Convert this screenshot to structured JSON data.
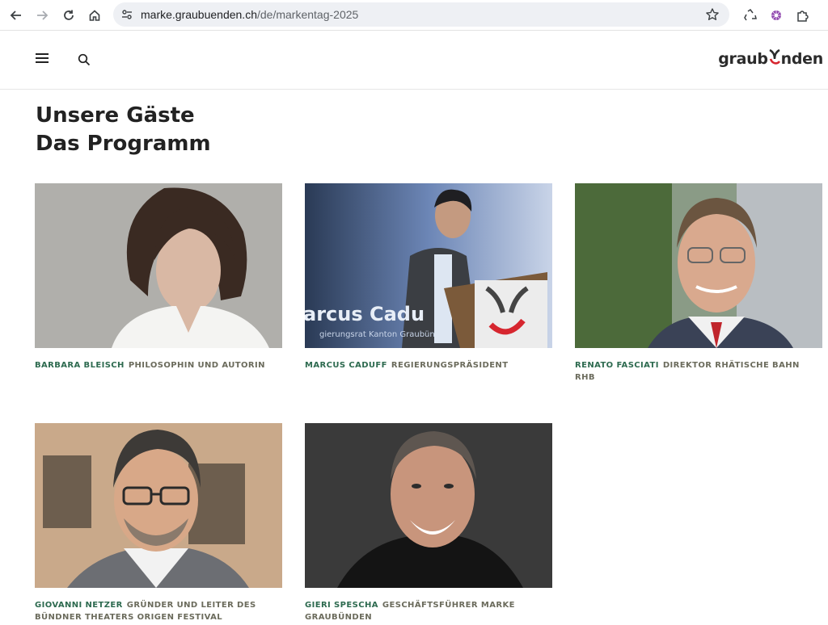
{
  "browser": {
    "url_host": "marke.graubuenden.ch",
    "url_path": "/de/markentag-2025"
  },
  "site": {
    "logo_text_left": "graub",
    "logo_text_right": "nden"
  },
  "page": {
    "heading": "Unsere Gäste",
    "subheading": "Das Programm"
  },
  "guests": [
    {
      "name": "BARBARA BLEISCH",
      "role": "PHILOSOPHIN UND AUTORIN"
    },
    {
      "name": "MARCUS CADUFF",
      "role": "REGIERUNGSPRÄSIDENT"
    },
    {
      "name": "RENATO FASCIATI",
      "role": "DIREKTOR RHÄTISCHE BAHN RHB"
    },
    {
      "name": "GIOVANNI NETZER",
      "role": "GRÜNDER UND LEITER DES BÜNDNER THEATERS ORIGEN FESTIVAL"
    },
    {
      "name": "GIERI SPESCHA",
      "role": "GESCHÄFTSFÜHRER MARKE GRAUBÜNDEN"
    }
  ],
  "photo_texts": {
    "lectern_banner": "arcus Cadu",
    "lectern_sub": "gierungsrat Kanton Graubün"
  },
  "colors": {
    "name_green": "#2d6a4f",
    "role_gray": "#6b6b5c",
    "logo_red": "#d6262f"
  }
}
